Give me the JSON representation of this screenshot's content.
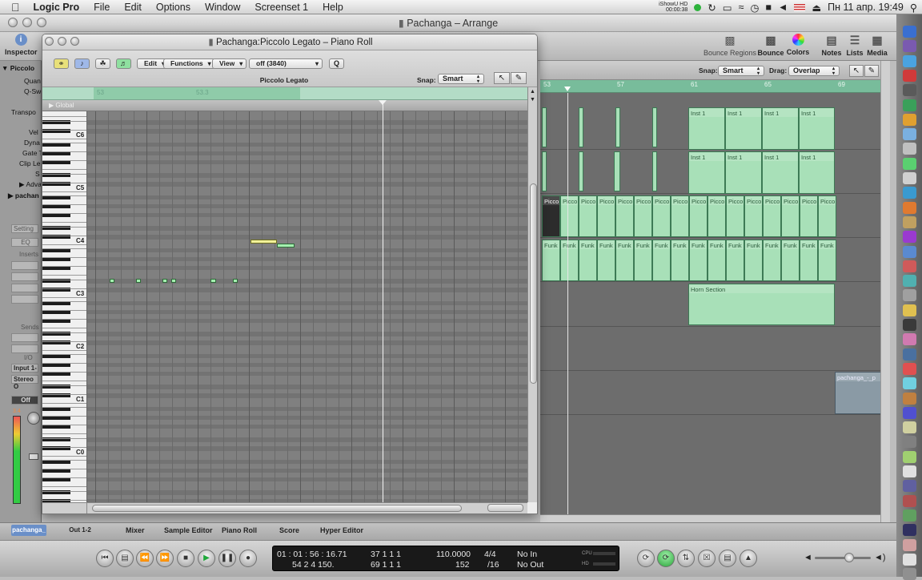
{
  "menubar": {
    "apple": "",
    "app": "Logic Pro",
    "items": [
      "File",
      "Edit",
      "Options",
      "Window",
      "Screenset 1",
      "Help"
    ],
    "recorder_name": "iShowU HD",
    "recorder_time": "00:00:38",
    "datetime": "Пн 11 апр.  19:49"
  },
  "window": {
    "title": "Pachanga – Arrange"
  },
  "toolbar": {
    "inspector": "Inspector",
    "bounce_regions": "Bounce Regions",
    "bounce": "Bounce",
    "colors": "Colors",
    "notes": "Notes",
    "lists": "Lists",
    "media": "Media"
  },
  "inspector": {
    "region": "Piccolo",
    "params": [
      "Quan",
      "Q-Sw",
      "Transpo",
      "Vel",
      "Dyna",
      "Gate T",
      "Clip Le",
      "S",
      "Adva",
      "pachan"
    ],
    "setting": "Setting",
    "eq": "EQ",
    "inserts": "Inserts",
    "sends": "Sends",
    "io": "I/O",
    "input": "Input 1-",
    "output": "Stereo O",
    "off": "Off",
    "meter_val": "3.4"
  },
  "arrange": {
    "snap_label": "Snap:",
    "snap_value": "Smart",
    "drag_label": "Drag:",
    "drag_value": "Overlap",
    "ruler": [
      "53",
      "57",
      "61",
      "65",
      "69"
    ],
    "inst_labels": [
      "Inst 1",
      "Inst 1",
      "Inst 1",
      "Inst 1"
    ],
    "picco_label": "Picco",
    "funk_label": "Funk",
    "horn_label": "Horn Section",
    "audio_label": "pachanga_-_p"
  },
  "piano_roll": {
    "title": "Pachanga:Piccolo Legato – Piano Roll",
    "menus": {
      "edit": "Edit",
      "functions": "Functions",
      "view": "View"
    },
    "quantize_value": "off (3840)",
    "q_button": "Q",
    "region_name": "Piccolo Legato",
    "snap_label": "Snap:",
    "snap_value": "Smart",
    "ruler": [
      "53",
      "53.3"
    ],
    "global_label": "Global",
    "octave_labels": [
      "C6",
      "C5",
      "C4",
      "C3",
      "C2",
      "C1",
      "C0"
    ],
    "notes": [
      {
        "bar": 0.05,
        "len": 0.012,
        "pitch": "D#3",
        "selected": false
      },
      {
        "bar": 0.11,
        "len": 0.012,
        "pitch": "D#3",
        "selected": false
      },
      {
        "bar": 0.17,
        "len": 0.012,
        "pitch": "D#3",
        "selected": false
      },
      {
        "bar": 0.19,
        "len": 0.012,
        "pitch": "D#3",
        "selected": false
      },
      {
        "bar": 0.28,
        "len": 0.012,
        "pitch": "D#3",
        "selected": false
      },
      {
        "bar": 0.33,
        "len": 0.012,
        "pitch": "D#3",
        "selected": false
      },
      {
        "bar": 0.37,
        "len": 0.06,
        "pitch": "C4",
        "selected": true
      },
      {
        "bar": 0.43,
        "len": 0.04,
        "pitch": "B3",
        "selected": false
      }
    ],
    "playhead_pos": 0.67
  },
  "tabs": {
    "region_name": "pachanga_",
    "output": "Out 1-2",
    "items": [
      "Mixer",
      "Sample Editor",
      "Piano Roll",
      "Score",
      "Hyper Editor"
    ]
  },
  "transport": {
    "smpte": "01 : 01 : 56 : 16.71",
    "bars_top": "37    1    1      1",
    "tempo": "110.0000",
    "sig": "4/4",
    "in": "No In",
    "bars_bottom_a": "54    2    4  150.",
    "bars_bottom_b": "69    1    1      1",
    "division_num": "152",
    "division": "/16",
    "out": "No Out",
    "cpu": "CPU",
    "hd": "HD"
  }
}
